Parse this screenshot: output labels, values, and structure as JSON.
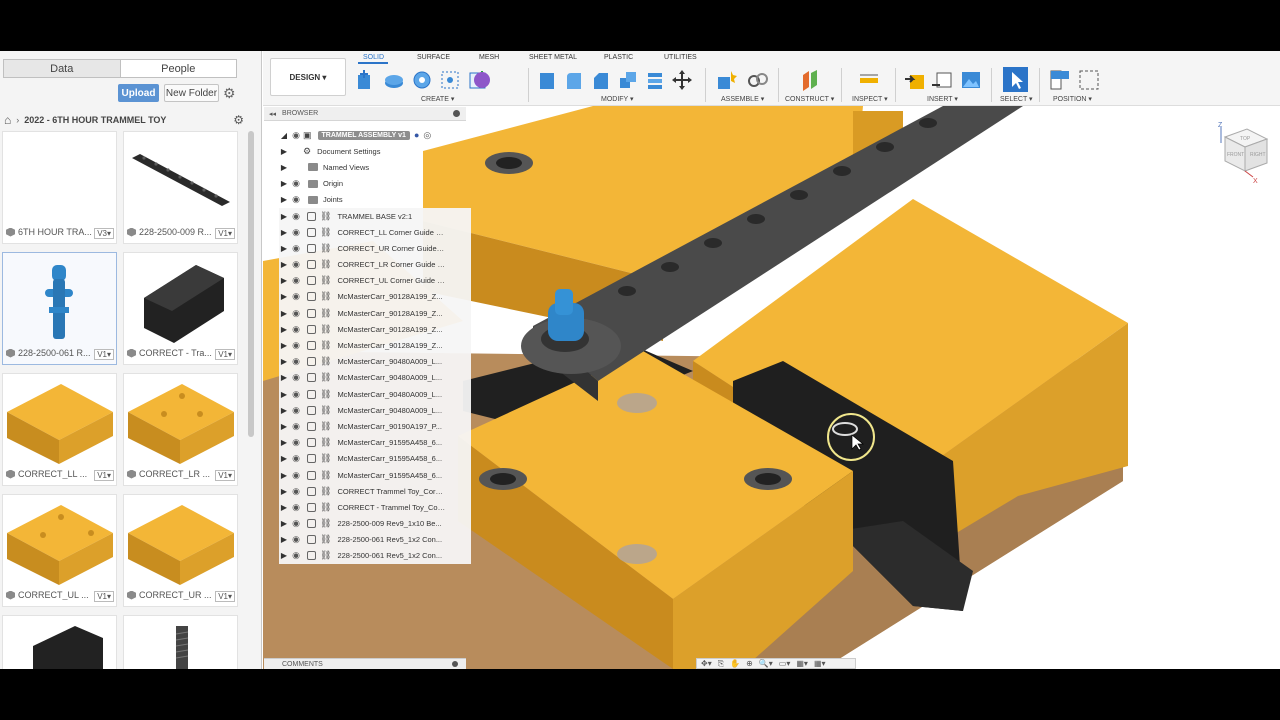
{
  "data_panel": {
    "tabs": [
      {
        "label": "Data",
        "active": true
      },
      {
        "label": "People",
        "active": false
      }
    ],
    "upload_label": "Upload",
    "new_folder_label": "New Folder",
    "breadcrumb": {
      "separator": "›",
      "project": "2022 - 6TH HOUR TRAMMEL TOY"
    },
    "items": [
      {
        "name": "6TH HOUR TRA...",
        "version": "V3"
      },
      {
        "name": "228-2500-009 R...",
        "version": "V1"
      },
      {
        "name": "228-2500-061 R...",
        "version": "V1",
        "selected": true
      },
      {
        "name": "CORRECT - Tra...",
        "version": "V1"
      },
      {
        "name": "CORRECT_LL ...",
        "version": "V1"
      },
      {
        "name": "CORRECT_LR ...",
        "version": "V1"
      },
      {
        "name": "CORRECT_UL ...",
        "version": "V1"
      },
      {
        "name": "CORRECT_UR ...",
        "version": "V1"
      },
      {
        "name": "",
        "version": ""
      },
      {
        "name": "",
        "version": ""
      }
    ]
  },
  "toolbar": {
    "workspace": "DESIGN",
    "tabs": [
      "SOLID",
      "SURFACE",
      "MESH",
      "SHEET METAL",
      "PLASTIC",
      "UTILITIES"
    ],
    "active_tab": "SOLID",
    "groups": [
      "CREATE",
      "MODIFY",
      "ASSEMBLE",
      "CONSTRUCT",
      "INSPECT",
      "INSERT",
      "SELECT",
      "POSITION"
    ]
  },
  "browser": {
    "title": "BROWSER",
    "root": "TRAMMEL ASSEMBLY v1",
    "nodes": [
      {
        "label": "Document Settings",
        "type": "settings"
      },
      {
        "label": "Named Views",
        "type": "folder"
      },
      {
        "label": "Origin",
        "type": "folder"
      },
      {
        "label": "Joints",
        "type": "folder"
      },
      {
        "label": "TRAMMEL BASE v2:1",
        "type": "base"
      },
      {
        "label": "CORRECT_LL Corner Guide B...",
        "type": "comp"
      },
      {
        "label": "CORRECT_UR Corner Guide B...",
        "type": "comp"
      },
      {
        "label": "CORRECT_LR Corner Guide B...",
        "type": "comp"
      },
      {
        "label": "CORRECT_UL Corner Guide B...",
        "type": "comp"
      },
      {
        "label": "McMasterCarr_90128A199_Z...",
        "type": "comp"
      },
      {
        "label": "McMasterCarr_90128A199_Z...",
        "type": "comp"
      },
      {
        "label": "McMasterCarr_90128A199_Z...",
        "type": "comp"
      },
      {
        "label": "McMasterCarr_90128A199_Z...",
        "type": "comp"
      },
      {
        "label": "McMasterCarr_90480A009_L...",
        "type": "comp"
      },
      {
        "label": "McMasterCarr_90480A009_L...",
        "type": "comp"
      },
      {
        "label": "McMasterCarr_90480A009_L...",
        "type": "comp"
      },
      {
        "label": "McMasterCarr_90480A009_L...",
        "type": "comp"
      },
      {
        "label": "McMasterCarr_90190A197_P...",
        "type": "comp"
      },
      {
        "label": "McMasterCarr_91595A458_6...",
        "type": "comp"
      },
      {
        "label": "McMasterCarr_91595A458_6...",
        "type": "comp"
      },
      {
        "label": "McMasterCarr_91595A458_6...",
        "type": "comp"
      },
      {
        "label": "CORRECT Trammel Toy_Corre...",
        "type": "comp"
      },
      {
        "label": "CORRECT - Trammel Toy_Cor...",
        "type": "comp"
      },
      {
        "label": "228-2500-009 Rev9_1x10 Be...",
        "type": "comp"
      },
      {
        "label": "228-2500-061 Rev5_1x2 Con...",
        "type": "comp"
      },
      {
        "label": "228-2500-061 Rev5_1x2 Con...",
        "type": "comp"
      }
    ]
  },
  "comments_label": "COMMENTS",
  "viewcube": {
    "top": "TOP",
    "front": "FRONT",
    "right": "RIGHT",
    "z": "Z",
    "x": "X"
  },
  "colors": {
    "wood": "#f2b233",
    "accent": "#2b74c8",
    "plastic_black": "#2a2a2a",
    "pin_blue": "#2f86c9",
    "mdf": "#b98a5a"
  }
}
